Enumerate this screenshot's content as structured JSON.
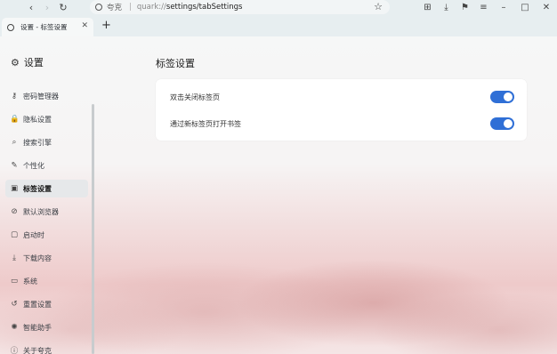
{
  "browser": {
    "site_name": "夸克",
    "url_host": "quark://",
    "url_path": "settings/tabSettings",
    "tab_title": "设置 - 标签设置",
    "new_tab_glyph": "+"
  },
  "sidebar": {
    "title": "设置",
    "items": [
      {
        "label": "密码管理器",
        "icon": "key-icon",
        "glyph": "⚷",
        "active": false
      },
      {
        "label": "隐私设置",
        "icon": "lock-icon",
        "glyph": "🔒",
        "active": false
      },
      {
        "label": "搜索引擎",
        "icon": "search-icon",
        "glyph": "⌕",
        "active": false
      },
      {
        "label": "个性化",
        "icon": "brush-icon",
        "glyph": "✎",
        "active": false
      },
      {
        "label": "标签设置",
        "icon": "tab-icon",
        "glyph": "▣",
        "active": true
      },
      {
        "label": "默认浏览器",
        "icon": "check-circle-icon",
        "glyph": "⊘",
        "active": false
      },
      {
        "label": "启动时",
        "icon": "startup-icon",
        "glyph": "▢",
        "active": false
      },
      {
        "label": "下载内容",
        "icon": "download-icon",
        "glyph": "⤓",
        "active": false
      },
      {
        "label": "系统",
        "icon": "monitor-icon",
        "glyph": "▭",
        "active": false
      },
      {
        "label": "重置设置",
        "icon": "reset-icon",
        "glyph": "↺",
        "active": false
      },
      {
        "label": "智能助手",
        "icon": "assistant-icon",
        "glyph": "✺",
        "active": false
      },
      {
        "label": "关于夸克",
        "icon": "info-icon",
        "glyph": "ⓘ",
        "active": false
      }
    ]
  },
  "main": {
    "title": "标签设置",
    "settings": [
      {
        "label": "双击关闭标签页",
        "enabled": true
      },
      {
        "label": "通过新标签页打开书签",
        "enabled": true
      }
    ]
  },
  "colors": {
    "accent": "#2f6fd6",
    "chrome": "#e7eef0"
  }
}
